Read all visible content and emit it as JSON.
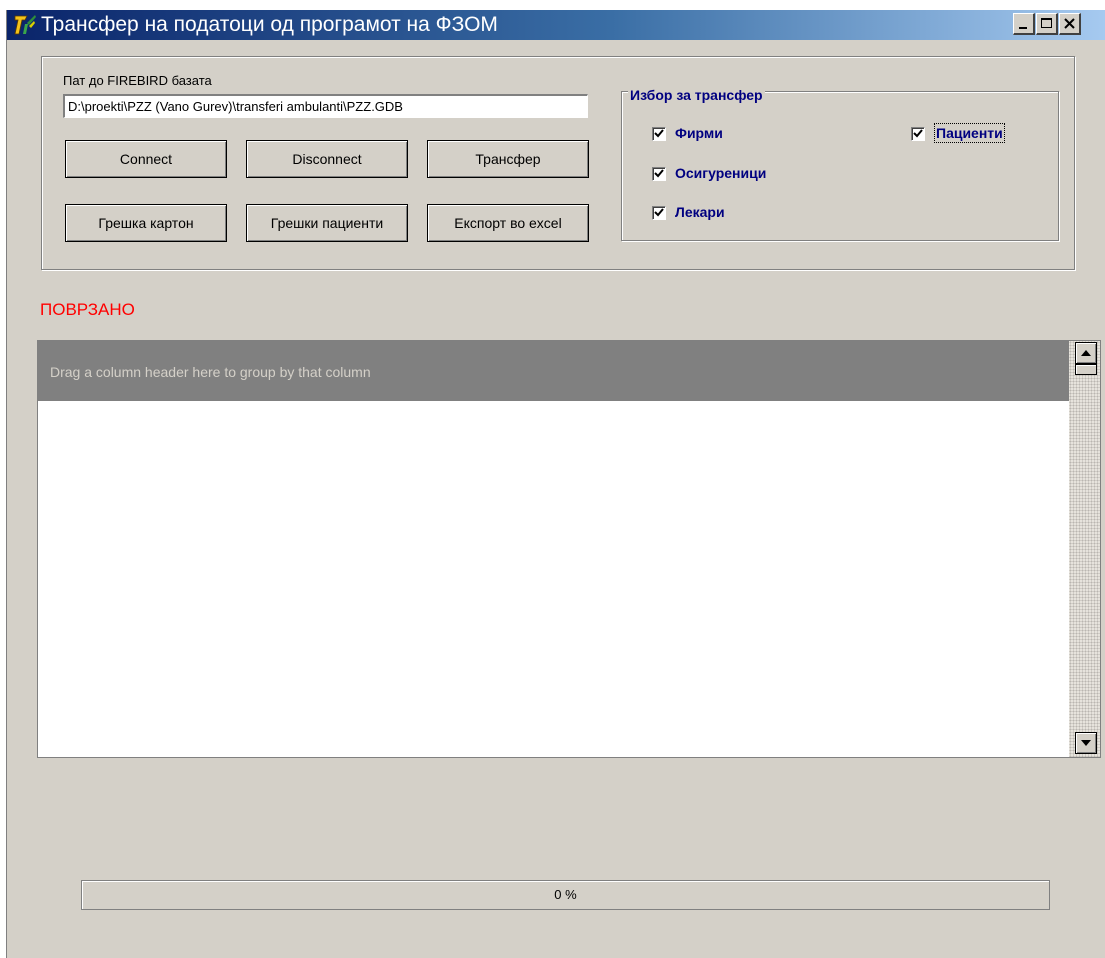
{
  "window": {
    "title": "Трансфер на податоци од програмот на ФЗОМ",
    "icon": "app-logo-icon",
    "controls": [
      "minimize-icon",
      "maximize-icon",
      "close-icon"
    ]
  },
  "connection": {
    "path_label": "Пат до FIREBIRD базата",
    "path_value": "D:\\proekti\\PZZ (Vano Gurev)\\transferi ambulanti\\PZZ.GDB"
  },
  "buttons": {
    "connect": "Connect",
    "disconnect": "Disconnect",
    "transfer": "Трансфер",
    "card_errors": "Грешка картон",
    "patient_errors": "Грешки пациенти",
    "export_excel": "Експорт во excel"
  },
  "transfer_selection": {
    "title": "Избор за трансфер",
    "firms": {
      "label": "Фирми",
      "checked": true
    },
    "insured": {
      "label": "Осигуреници",
      "checked": true
    },
    "doctors": {
      "label": "Лекари",
      "checked": true
    },
    "patients": {
      "label": "Пациенти",
      "checked": true
    }
  },
  "status": {
    "text": "ПОВРЗАНО",
    "color": "#ff0000"
  },
  "grid": {
    "group_panel_text": "Drag a column header here to group by that column"
  },
  "progress": {
    "value": 0,
    "text": "0 %"
  },
  "colors": {
    "title_start": "#0a246a",
    "title_end": "#a6caf0",
    "face": "#d4d0c8",
    "label_blue": "#000080"
  }
}
